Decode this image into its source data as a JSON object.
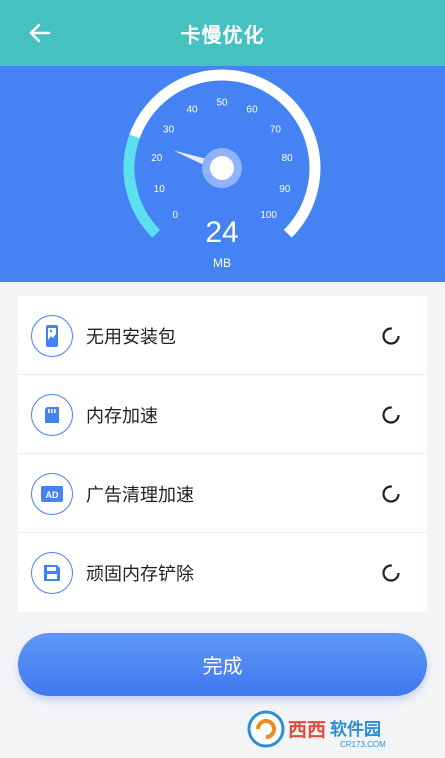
{
  "header": {
    "title": "卡慢优化",
    "back_icon": "arrow-left-icon"
  },
  "gauge": {
    "ticks": [
      "0",
      "10",
      "20",
      "30",
      "40",
      "50",
      "60",
      "70",
      "80",
      "90",
      "100"
    ],
    "value": "24",
    "unit": "MB",
    "current_value": 24,
    "max_value": 100,
    "colors": {
      "panel": "#4582f4",
      "track": "#ffffff",
      "progress": "#5ce0f0"
    }
  },
  "items": [
    {
      "label": "无用安装包",
      "icon": "phone-image-icon"
    },
    {
      "label": "内存加速",
      "icon": "memory-card-icon"
    },
    {
      "label": "广告清理加速",
      "icon": "ad-icon"
    },
    {
      "label": "顽固内存铲除",
      "icon": "floppy-disk-icon"
    }
  ],
  "done_button": {
    "label": "完成"
  },
  "watermark": {
    "text": "西西软件园",
    "subtext": "CR173.COM"
  },
  "colors": {
    "header": "#45c1bf",
    "accent": "#4582f4"
  }
}
